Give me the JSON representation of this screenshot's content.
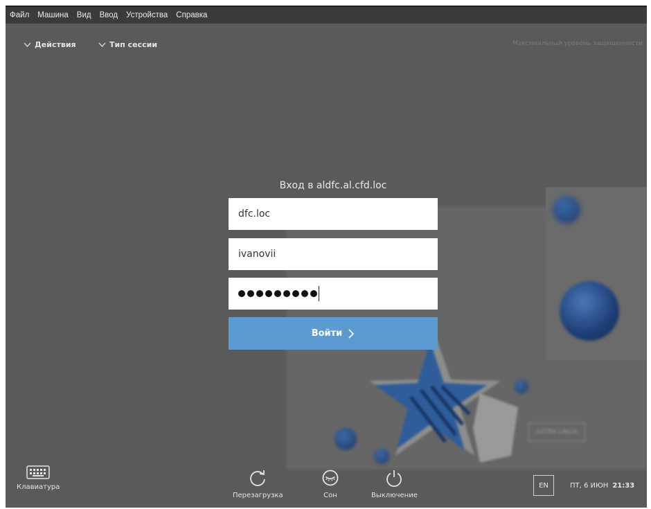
{
  "menubar": {
    "items": [
      "Файл",
      "Машина",
      "Вид",
      "Ввод",
      "Устройства",
      "Справка"
    ]
  },
  "topbar": {
    "actions_label": "Действия",
    "session_type_label": "Тип сессии",
    "security_level": "Максимальный уровень защищенности"
  },
  "login": {
    "title": "Вход в aldfc.al.cfd.loc",
    "domain_value": "dfc.loc",
    "username_value": "ivanovii",
    "password_mask_count": 9,
    "submit_label": "Войти"
  },
  "bottombar": {
    "keyboard_label": "Клавиатура",
    "reboot_label": "Перезагрузка",
    "sleep_label": "Сон",
    "shutdown_label": "Выключение",
    "language": "EN",
    "date": "ПТ, 6 ИЮН",
    "time": "21:33"
  },
  "decor": {
    "badge_text": "ASTRA LINUX"
  },
  "colors": {
    "background": "#5a5a5a",
    "menubar": "#3a3b3c",
    "accent_button": "#5c9bd1",
    "decor_blue": "#1d3e75"
  }
}
